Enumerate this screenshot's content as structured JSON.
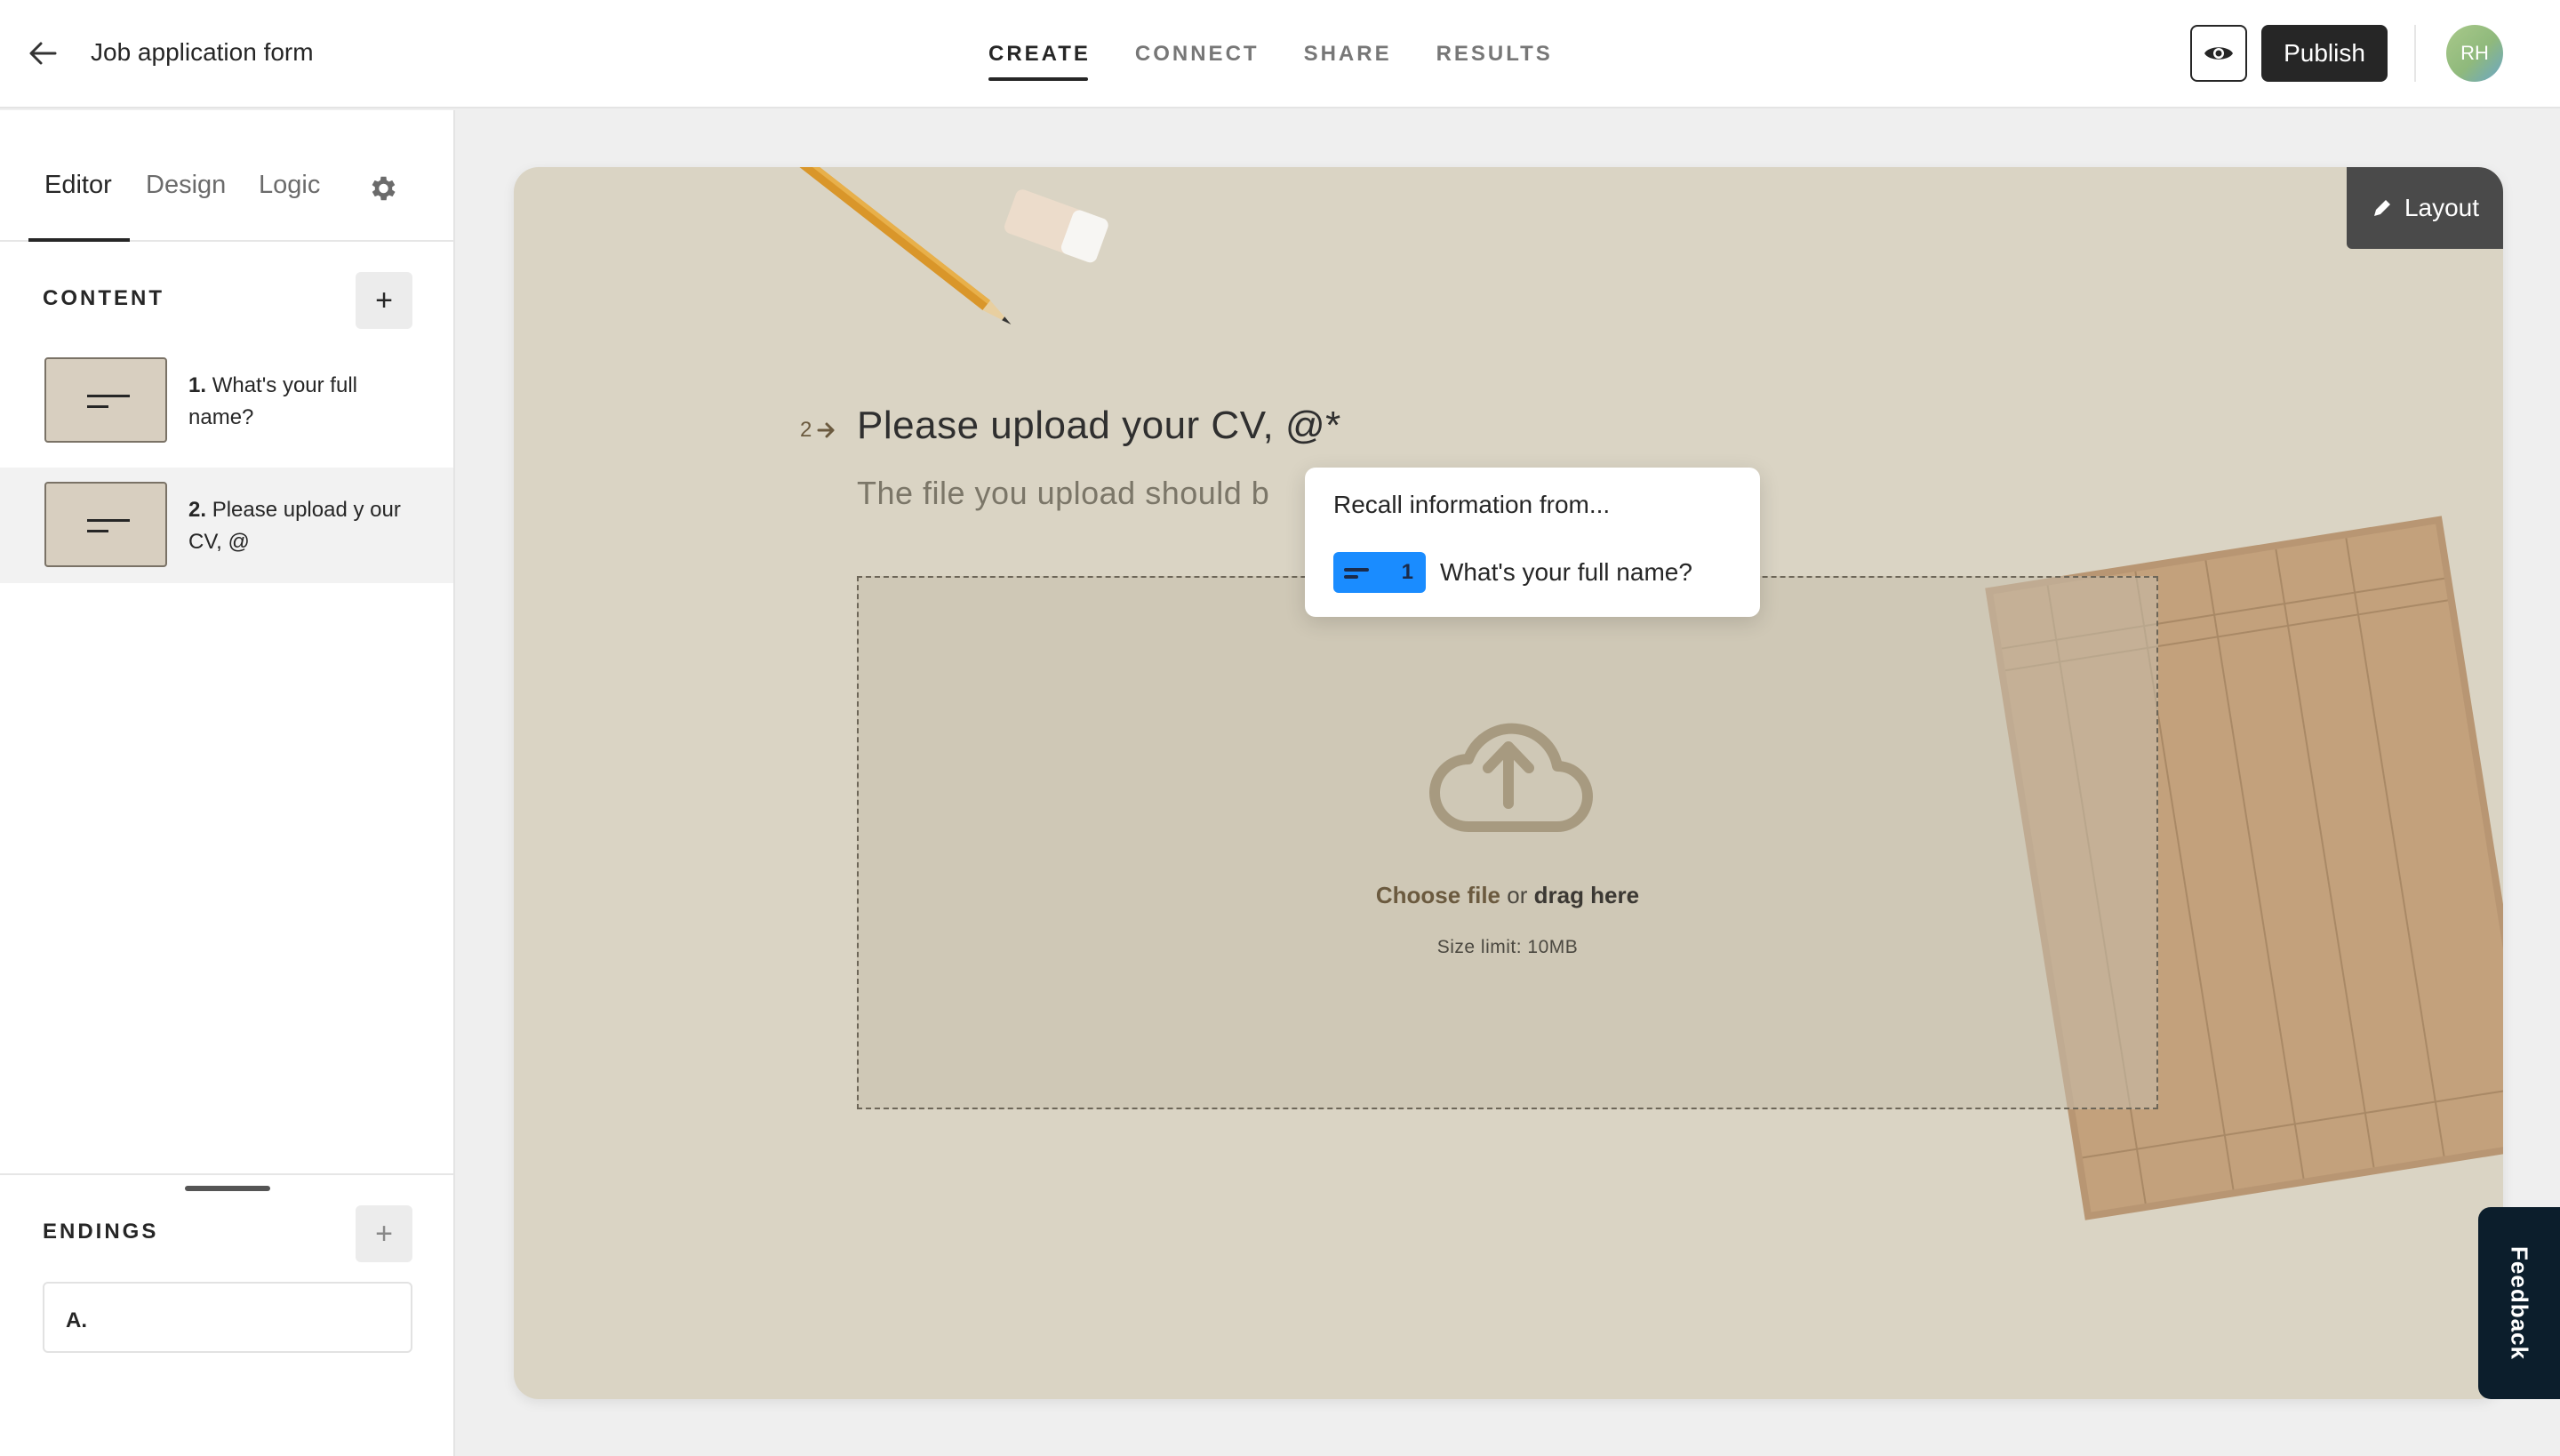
{
  "header": {
    "title": "Job application form",
    "tabs": [
      {
        "label": "CREATE",
        "active": true
      },
      {
        "label": "CONNECT",
        "active": false
      },
      {
        "label": "SHARE",
        "active": false
      },
      {
        "label": "RESULTS",
        "active": false
      }
    ],
    "publish_label": "Publish",
    "avatar_initials": "RH"
  },
  "sidebar": {
    "tabs": [
      {
        "label": "Editor",
        "active": true
      },
      {
        "label": "Design",
        "active": false
      },
      {
        "label": "Logic",
        "active": false
      }
    ],
    "content_title": "CONTENT",
    "questions": [
      {
        "number": "1.",
        "text": "What's your full name?",
        "selected": false
      },
      {
        "number": "2.",
        "text": "Please upload y our CV, @",
        "selected": true
      }
    ],
    "endings_title": "ENDINGS",
    "endings": [
      {
        "label": "A."
      }
    ]
  },
  "canvas": {
    "layout_label": "Layout",
    "question_number": "2",
    "question_title": "Please upload your CV, @*",
    "question_description": "The file you upload should b",
    "choose_file": "Choose file",
    "or_text": "or",
    "drag_here": "drag here",
    "size_limit": "Size limit: 10MB"
  },
  "recall_popup": {
    "title": "Recall information from...",
    "options": [
      {
        "number": "1",
        "label": "What's your full name?"
      }
    ]
  },
  "feedback_label": "Feedback",
  "colors": {
    "accent_dark": "#262626",
    "canvas_bg": "#dad4c4",
    "recall_chip": "#1a8cff",
    "link_brown": "#6b5a3f"
  }
}
